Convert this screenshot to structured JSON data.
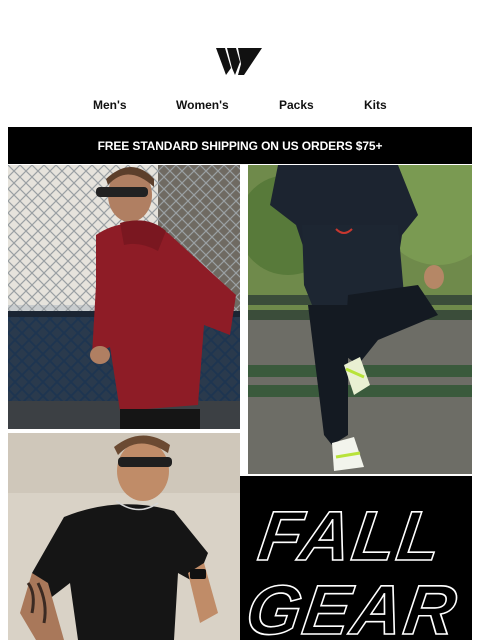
{
  "brand": {
    "logo_icon": "brand-logo-icon"
  },
  "nav": {
    "items": [
      {
        "label": "Men's"
      },
      {
        "label": "Women's"
      },
      {
        "label": "Packs"
      },
      {
        "label": "Kits"
      }
    ]
  },
  "banner": {
    "text": "FREE STANDARD SHIPPING ON US ORDERS $75+"
  },
  "hero": {
    "headline_line1": "FALL",
    "headline_line2": "GEAR"
  },
  "colors": {
    "banner_bg": "#000000",
    "banner_text": "#ffffff",
    "hoodie": "#8e1c26",
    "text": "#111111"
  }
}
